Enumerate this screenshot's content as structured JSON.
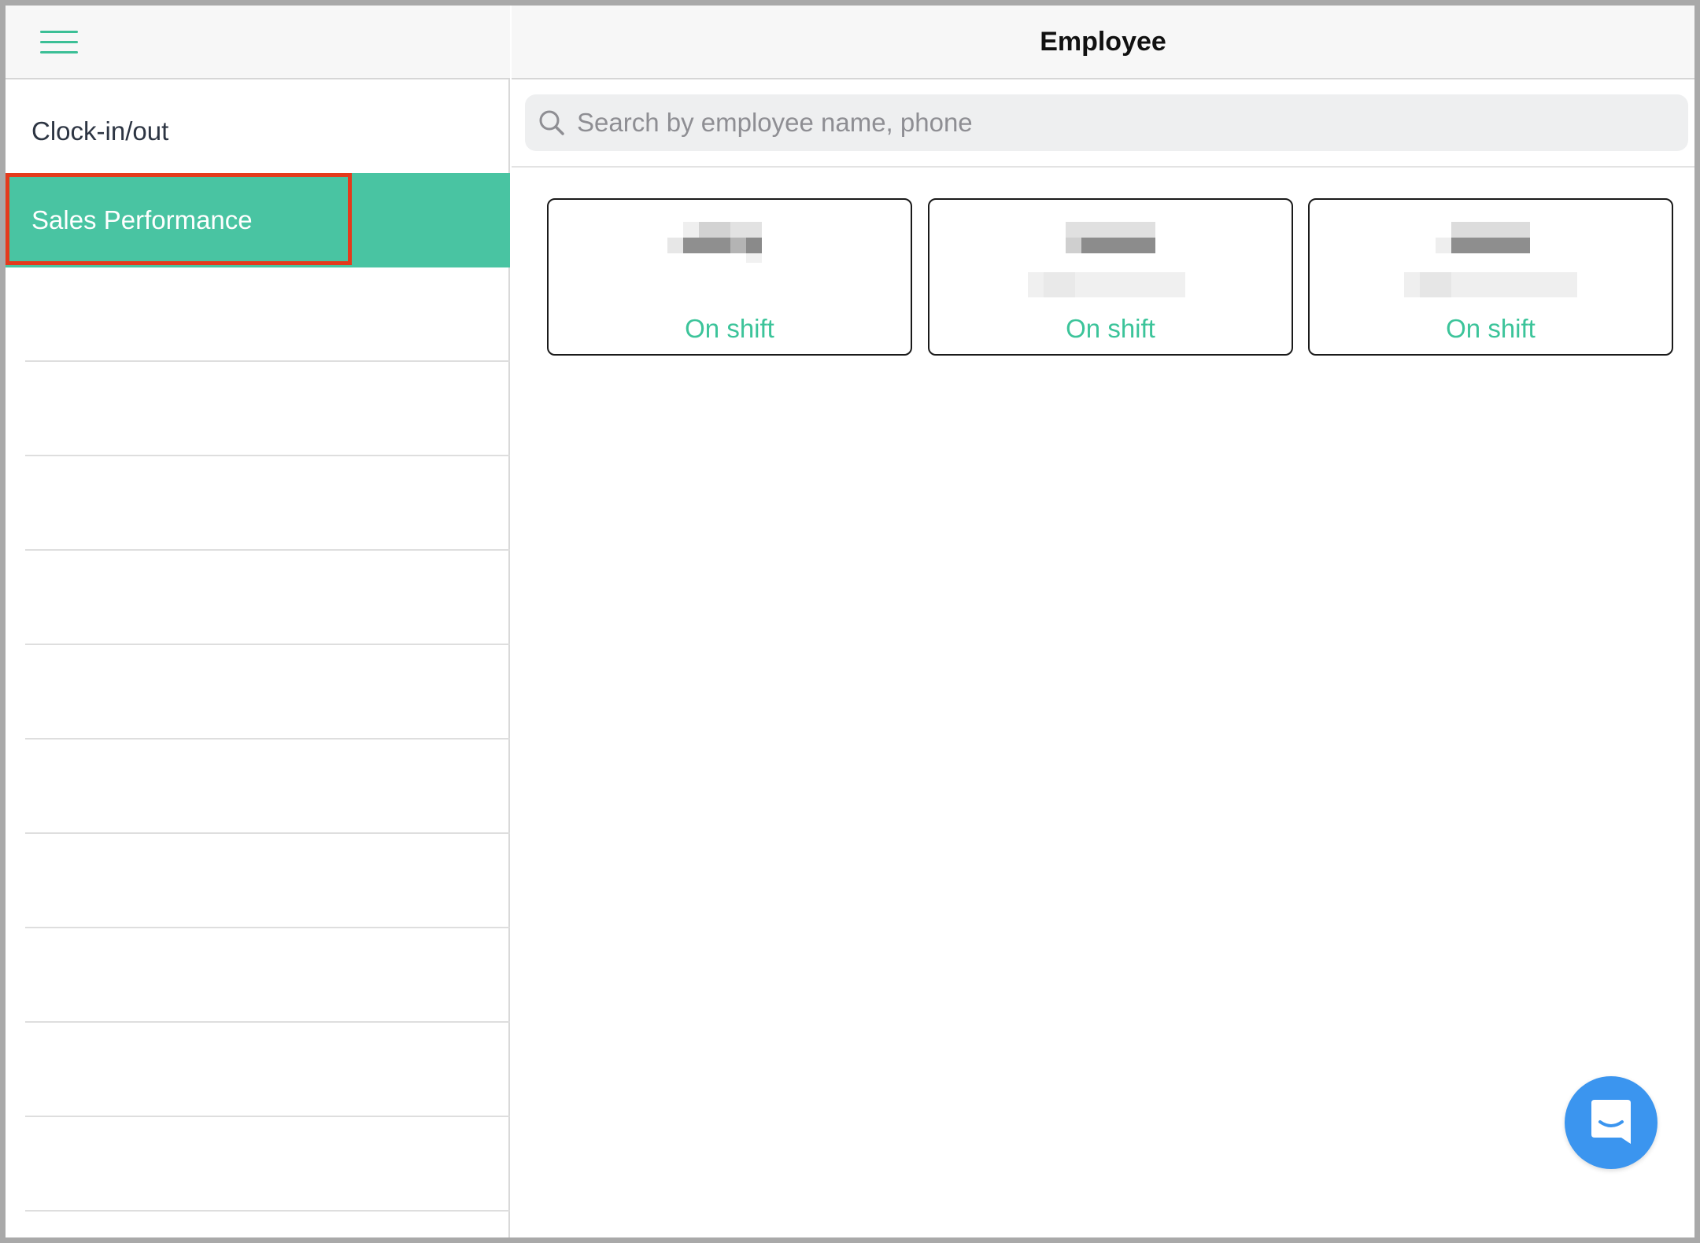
{
  "header": {
    "title": "Employee"
  },
  "sidebar": {
    "items": [
      {
        "label": "Clock-in/out",
        "selected": false
      },
      {
        "label": "Sales Performance",
        "selected": true
      }
    ]
  },
  "search": {
    "placeholder": "Search by employee name, phone",
    "value": ""
  },
  "employees": [
    {
      "status": "On shift"
    },
    {
      "status": "On shift"
    },
    {
      "status": "On shift"
    }
  ],
  "colors": {
    "accent": "#49c4a2",
    "status_text": "#3cc49a",
    "selection_outline": "#e43a1c",
    "chat_button": "#3b95ef"
  },
  "icons": [
    "hamburger-menu-icon",
    "search-icon",
    "chat-icon"
  ]
}
